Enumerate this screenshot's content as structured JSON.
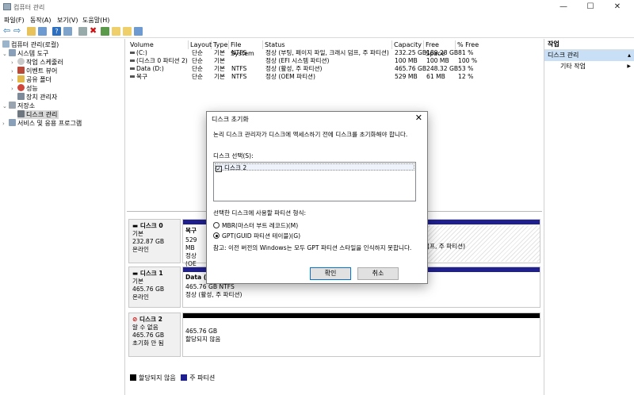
{
  "window": {
    "title": "컴퓨터 관리",
    "minimize": "—",
    "maximize": "☐",
    "close": "✕"
  },
  "menu": [
    "파일(F)",
    "동작(A)",
    "보기(V)",
    "도움말(H)"
  ],
  "tree": [
    {
      "label": "컴퓨터 관리(로컬)",
      "icon": "computer-icon"
    },
    {
      "label": "시스템 도구",
      "icon": "tools-icon"
    },
    {
      "label": "작업 스케줄러",
      "icon": "clock-icon"
    },
    {
      "label": "이벤트 뷰어",
      "icon": "event-viewer-icon"
    },
    {
      "label": "공유 폴더",
      "icon": "folder-icon"
    },
    {
      "label": "성능",
      "icon": "performance-icon"
    },
    {
      "label": "장치 관리자",
      "icon": "device-manager-icon"
    },
    {
      "label": "저장소",
      "icon": "storage-icon"
    },
    {
      "label": "디스크 관리",
      "icon": "disk-icon"
    },
    {
      "label": "서비스 및 응용 프로그램",
      "icon": "services-icon"
    }
  ],
  "volumes": {
    "headers": [
      "Volume",
      "Layout",
      "Type",
      "File System",
      "Status",
      "Capacity",
      "Free Space",
      "% Free"
    ],
    "rows": [
      [
        "(C:)",
        "단순",
        "기본",
        "NTFS",
        "정상 (부팅, 페이지 파일, 크래시 덤프, 주 파티션)",
        "232.25 GB",
        "189.28 GB",
        "81 %"
      ],
      [
        "(디스크 0 파티션 2)",
        "단순",
        "기본",
        "",
        "정상 (EFI 시스템 파티션)",
        "100 MB",
        "100 MB",
        "100 %"
      ],
      [
        "Data (D:)",
        "단순",
        "기본",
        "NTFS",
        "정상 (활성, 주 파티션)",
        "465.76 GB",
        "248.32 GB",
        "53 %"
      ],
      [
        "복구",
        "단순",
        "기본",
        "NTFS",
        "정상 (OEM 파티션)",
        "529 MB",
        "61 MB",
        "12 %"
      ]
    ]
  },
  "disks": [
    {
      "name": "디스크 0",
      "type": "기본",
      "size": "232.87 GB",
      "status": "온라인",
      "part_name": "복구",
      "part_size": "529 MB",
      "part_status": "정상 (OE",
      "part_right": "덤프, 주 파티션)"
    },
    {
      "name": "디스크 1",
      "type": "기본",
      "size": "465.76 GB",
      "status": "온라인",
      "part_name": "Data (D",
      "part_size": "465.76 GB NTFS",
      "part_status": "정상 (활성, 주 파티션)"
    },
    {
      "name": "디스크 2",
      "type": "알 수 없음",
      "size": "465.76 GB",
      "status": "초기화 안 됨",
      "part_size": "465.76 GB",
      "part_status": "할당되지 않음"
    }
  ],
  "legend": [
    {
      "label": "할당되지 않음",
      "color": "#000000"
    },
    {
      "label": "주 파티션",
      "color": "#1f1f8f"
    }
  ],
  "actions": {
    "header": "작업",
    "selected": "디스크 관리",
    "more": "기타 작업",
    "arrow": "▶"
  },
  "dialog": {
    "title": "디스크 초기화",
    "close": "✕",
    "intro": "논리 디스크 관리자가 디스크에 액세스하기 전에 디스크를 초기화해야 합니다.",
    "select_label": "디스크 선택(S):",
    "disk_item": "디스크 2",
    "style_label": "선택한 디스크에 사용할 파티션 형식:",
    "mbr": "MBR(마스터 부트 레코드)(M)",
    "gpt": "GPT(GUID 파티션 테이블)(G)",
    "note": "참고: 이전 버전의 Windows는 모두 GPT 파티션 스타일을 인식하지 못합니다.",
    "ok": "확인",
    "cancel": "취소"
  }
}
